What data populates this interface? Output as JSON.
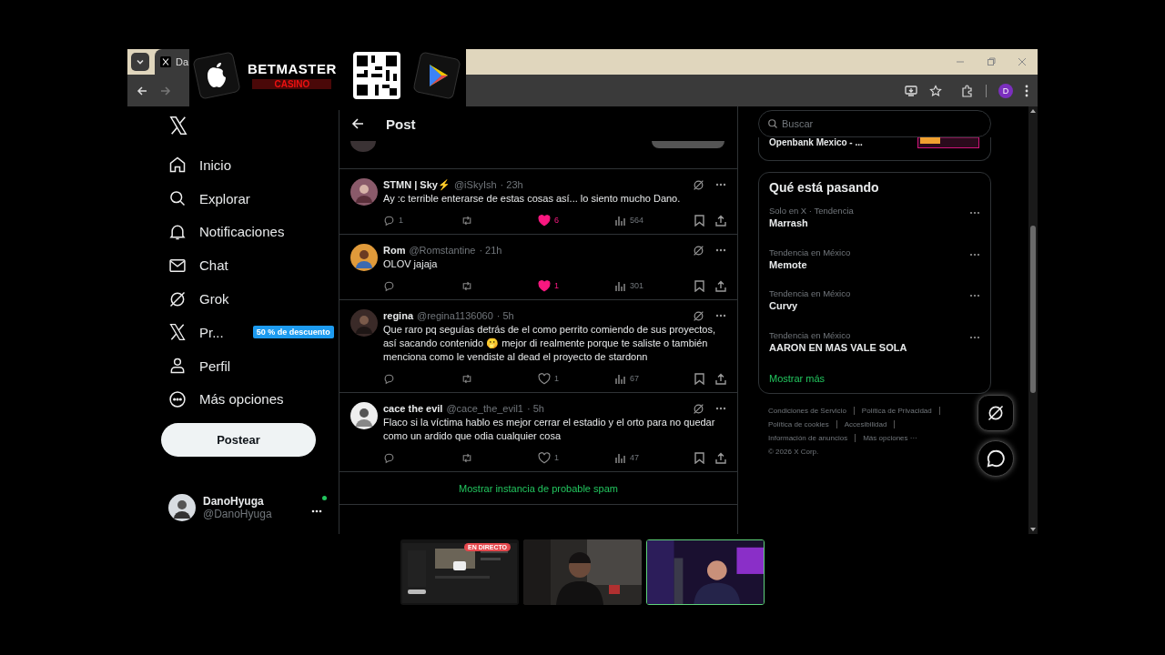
{
  "browser": {
    "tab_title": "Da",
    "profile_initial": "D"
  },
  "ad": {
    "brand": "BETMASTER",
    "sub": "CASINO"
  },
  "nav": {
    "items": [
      {
        "kind": "home",
        "label": "Inicio"
      },
      {
        "kind": "search",
        "label": "Explorar"
      },
      {
        "kind": "bell",
        "label": "Notificaciones"
      },
      {
        "kind": "mail",
        "label": "Chat"
      },
      {
        "kind": "grok",
        "label": "Grok"
      },
      {
        "kind": "x",
        "label": "Pr...",
        "badge": "50 % de descuento"
      },
      {
        "kind": "person",
        "label": "Perfil"
      },
      {
        "kind": "more",
        "label": "Más opciones"
      }
    ],
    "post_button": "Postear",
    "account": {
      "name": "DanoHyuga",
      "handle": "@DanoHyuga",
      "online": true
    }
  },
  "post_header": {
    "title": "Post"
  },
  "replies": [
    {
      "name": "STMN  | Sky⚡",
      "handle": "@iSkyIsh",
      "time": "· 23h",
      "text": "Ay :c terrible enterarse de estas cosas así... lo siento mucho Dano.",
      "replies": "1",
      "likes": "6",
      "liked": true,
      "views": "564"
    },
    {
      "name": "Rom",
      "handle": "@Romstantine",
      "time": "· 21h",
      "text": "OLOV jajaja",
      "likes": "1",
      "liked": true,
      "views": "301"
    },
    {
      "name": "regina",
      "handle": "@regina1136060",
      "time": "· 5h",
      "text": "Que raro pq seguías detrás de el como perrito comiendo de sus proyectos, así sacando contenido 🫢 mejor di realmente porque te saliste o también menciona como le vendiste al dead el proyecto de stardonn",
      "likes": "1",
      "liked": false,
      "views": "67"
    },
    {
      "name": "cace the evil",
      "handle": "@cace_the_evil1",
      "time": "· 5h",
      "text": "Flaco si la víctima hablo es mejor cerrar el estadio y el orto para no quedar como un ardido que odia cualquier cosa",
      "likes": "1",
      "liked": false,
      "views": "47"
    }
  ],
  "spam_link": "Mostrar instancia de probable spam",
  "search": {
    "placeholder": "Buscar"
  },
  "ad_card": {
    "title": "Openbank Mexico - ..."
  },
  "trends": {
    "title": "Qué está pasando",
    "items": [
      {
        "context": "Solo en X · Tendencia",
        "topic": "Marrash"
      },
      {
        "context": "Tendencia en México",
        "topic": "Memote"
      },
      {
        "context": "Tendencia en México",
        "topic": "Curvy"
      },
      {
        "context": "Tendencia en México",
        "topic": "AARON EN MAS VALE SOLA"
      }
    ],
    "more": "Mostrar más"
  },
  "footer": {
    "links": [
      "Condiciones de Servicio",
      "Política de Privacidad",
      "Política de cookies",
      "Accesibilidad",
      "Información de anuncios",
      "Más opciones ···"
    ],
    "copyright": "© 2026 X Corp."
  },
  "stream": {
    "live_badge": "EN DIRECTO"
  }
}
